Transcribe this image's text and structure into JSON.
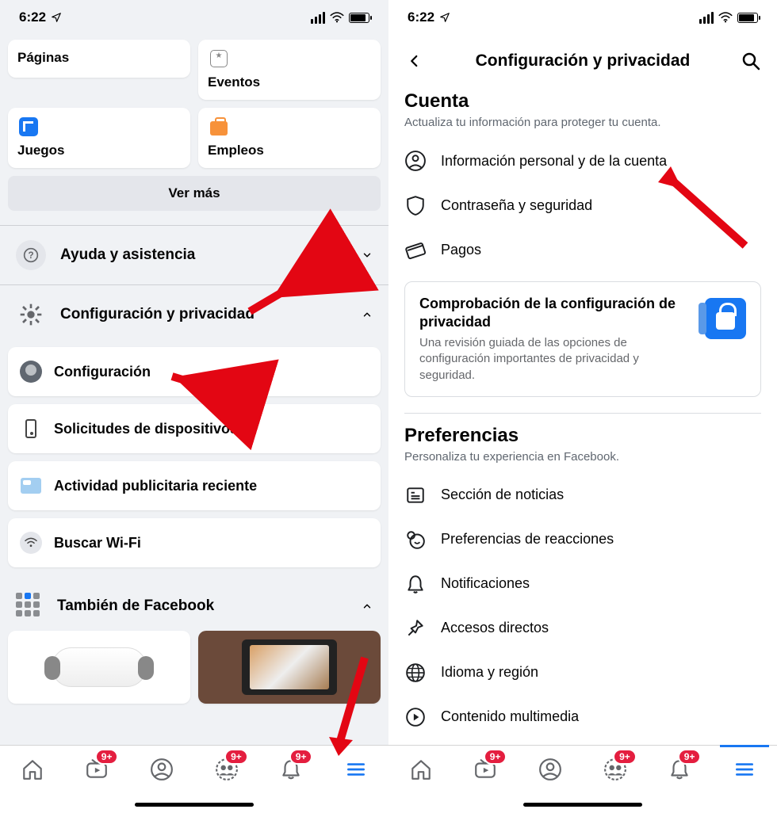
{
  "status": {
    "time": "6:22"
  },
  "left": {
    "shortcuts": {
      "pages": "Páginas",
      "events": "Eventos",
      "games": "Juegos",
      "jobs": "Empleos"
    },
    "see_more": "Ver más",
    "help_row": "Ayuda y asistencia",
    "settings_row": "Configuración y privacidad",
    "subitems": {
      "config": "Configuración",
      "devices": "Solicitudes de dispositivos",
      "ads": "Actividad publicitaria reciente",
      "wifi": "Buscar Wi-Fi"
    },
    "also_from": "También de Facebook"
  },
  "right": {
    "header_title": "Configuración y privacidad",
    "account": {
      "title": "Cuenta",
      "desc": "Actualiza tu información para proteger tu cuenta.",
      "items": {
        "personal": "Información personal y de la cuenta",
        "password": "Contraseña y seguridad",
        "payments": "Pagos"
      }
    },
    "promo": {
      "title": "Comprobación de la configuración de privacidad",
      "desc": "Una revisión guiada de las opciones de configuración importantes de privacidad y seguridad."
    },
    "prefs": {
      "title": "Preferencias",
      "desc": "Personaliza tu experiencia en Facebook.",
      "items": {
        "news": "Sección de noticias",
        "reactions": "Preferencias de reacciones",
        "notif": "Notificaciones",
        "shortcuts": "Accesos directos",
        "lang": "Idioma y región",
        "media": "Contenido multimedia"
      }
    }
  },
  "badge": "9+"
}
